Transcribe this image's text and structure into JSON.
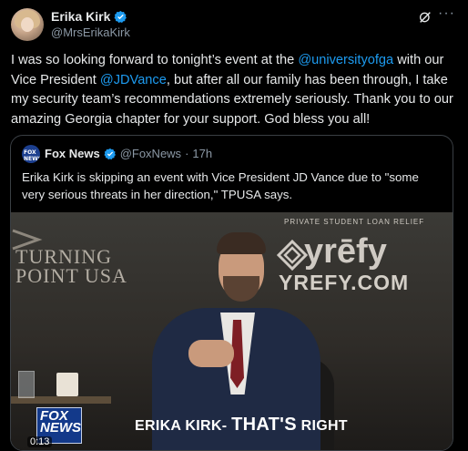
{
  "post": {
    "author": {
      "display_name": "Erika Kirk",
      "handle": "@MrsErikaKirk"
    },
    "text_parts": [
      {
        "text": "I was so looking forward to tonight’s event at the ",
        "type": "text"
      },
      {
        "text": "@universityofga",
        "type": "mention"
      },
      {
        "text": " with our Vice President ",
        "type": "text"
      },
      {
        "text": "@JDVance",
        "type": "mention"
      },
      {
        "text": ", but after all our family has been through, I take my security team’s recommendations extremely seriously. Thank you to our amazing Georgia chapter for your support. God bless you all!",
        "type": "text"
      }
    ],
    "icons": {
      "verified": "verified-badge-icon",
      "grok": "grok-icon",
      "more": "more-options-icon"
    },
    "colors": {
      "accent": "#1d9bf0",
      "secondary_text": "#8b98a5",
      "background": "#000000"
    }
  },
  "quote": {
    "author": {
      "display_name": "Fox News",
      "handle": "@FoxNews",
      "time": "17h"
    },
    "logo_text": "FOX NEWS",
    "text": "Erika Kirk is skipping an event with Vice President JD Vance due to \"some very serious threats in her direction,\" TPUSA says.",
    "video": {
      "backdrop_left": "TURNING\nPOINT USA",
      "sponsor_tagline": "PRIVATE STUDENT LOAN RELIEF",
      "sponsor_name": "yrēfy",
      "sponsor_url": "YREFY.COM",
      "network_bug": "FOX\nNEWS",
      "caption_prefix": "ERIKA KIRK- ",
      "caption_emphasis": "THAT'S",
      "caption_suffix": " RIGHT",
      "elapsed": "0:13"
    }
  }
}
